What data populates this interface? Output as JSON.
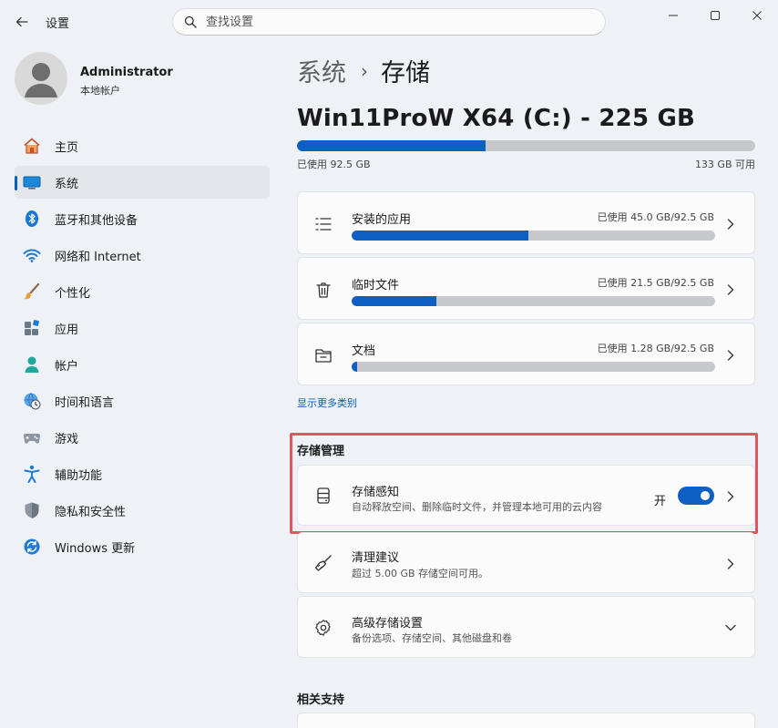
{
  "window": {
    "title": "设置",
    "search_placeholder": "查找设置"
  },
  "user": {
    "name": "Administrator",
    "account_type": "本地帐户"
  },
  "sidebar": {
    "items": [
      {
        "label": "主页",
        "icon": "home-icon"
      },
      {
        "label": "系统",
        "icon": "system-icon",
        "active": true
      },
      {
        "label": "蓝牙和其他设备",
        "icon": "bluetooth-icon"
      },
      {
        "label": "网络和 Internet",
        "icon": "wifi-icon"
      },
      {
        "label": "个性化",
        "icon": "brush-icon"
      },
      {
        "label": "应用",
        "icon": "apps-icon"
      },
      {
        "label": "帐户",
        "icon": "person-icon"
      },
      {
        "label": "时间和语言",
        "icon": "globe-clock-icon"
      },
      {
        "label": "游戏",
        "icon": "gamepad-icon"
      },
      {
        "label": "辅助功能",
        "icon": "accessibility-icon"
      },
      {
        "label": "隐私和安全性",
        "icon": "shield-icon"
      },
      {
        "label": "Windows 更新",
        "icon": "update-icon"
      }
    ]
  },
  "header": {
    "breadcrumb_parent": "系统",
    "breadcrumb_separator": "›",
    "breadcrumb_current": "存储"
  },
  "drive": {
    "title": "Win11ProW X64 (C:) - 225 GB",
    "used_label": "已使用 92.5 GB",
    "free_label": "133 GB 可用",
    "used_fraction": 0.411
  },
  "categories": [
    {
      "title": "安装的应用",
      "meta": "已使用 45.0 GB/92.5 GB",
      "fraction": 0.486,
      "icon": "list-icon"
    },
    {
      "title": "临时文件",
      "meta": "已使用 21.5 GB/92.5 GB",
      "fraction": 0.232,
      "icon": "trash-icon"
    },
    {
      "title": "文档",
      "meta": "已使用 1.28 GB/92.5 GB",
      "fraction": 0.014,
      "icon": "folder-icon"
    }
  ],
  "show_more_link": "显示更多类别",
  "storage_management": {
    "section_title": "存储管理",
    "storage_sense": {
      "title": "存储感知",
      "subtitle": "自动释放空间、删除临时文件，并管理本地可用的云内容",
      "toggle_label": "开",
      "toggle_on": true
    },
    "cleanup": {
      "title": "清理建议",
      "subtitle": "超过 5.00 GB 存储空间可用。"
    },
    "advanced": {
      "title": "高级存储设置",
      "subtitle": "备份选项、存储空间、其他磁盘和卷"
    }
  },
  "related_support": {
    "section_title": "相关支持"
  },
  "colors": {
    "accent": "#0e5fc2",
    "highlight_border": "#e05560",
    "bar_track": "#c7c8cc"
  }
}
